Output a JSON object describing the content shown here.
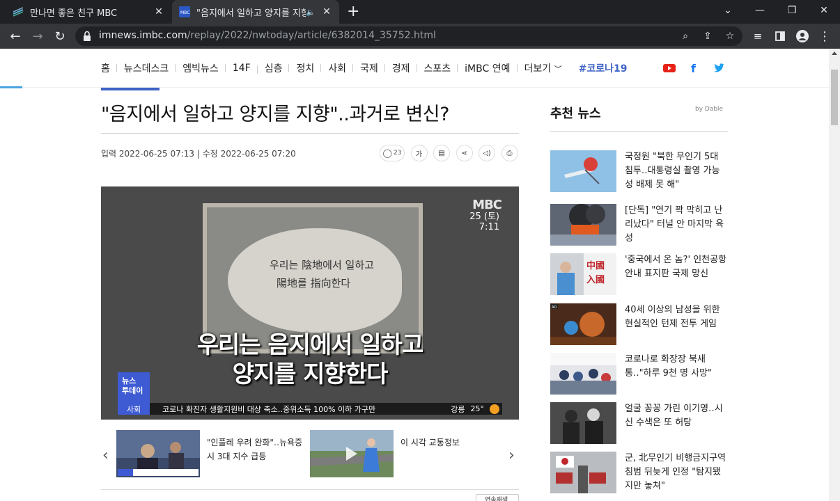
{
  "browser": {
    "tabs": [
      {
        "title": "만나면 좋은 친구 MBC",
        "active": false
      },
      {
        "title": "\"음지에서 일하고 양지를 지향\"..과거로 변신?",
        "active": true
      }
    ],
    "url_host": "imnews.imbc.com",
    "url_path": "/replay/2022/nwtoday/article/6382014_35752.html"
  },
  "nav": {
    "items": [
      "홈",
      "뉴스데스크",
      "엠빅뉴스",
      "14F",
      "심층",
      "정치",
      "사회",
      "국제",
      "경제",
      "스포츠",
      "iMBC 연예",
      "더보기"
    ],
    "covid": "#코로나19"
  },
  "article": {
    "headline": "\"음지에서 일하고 양지를 지향\"..과거로 변신?",
    "dates": "입력 2022-06-25 07:13 | 수정 2022-06-25 07:20",
    "comment_count": "23",
    "font_tool": "가"
  },
  "video": {
    "logo": "MBC",
    "date": "25 (토)",
    "time": "7:11",
    "rock_line1": "우리는 陰地에서 일하고",
    "rock_line2": "陽地를 指向한다",
    "caption1": "우리는 음지에서 일하고",
    "caption2": "양지를 지향한다",
    "badge_line1": "뉴스",
    "badge_line2": "투데이",
    "ticker_section": "사회",
    "ticker_text": "코로나 확진자 생활지원비 대상 축소‥중위소득 100% 이하 가구만",
    "weather_city": "강릉",
    "weather_temp": "25°"
  },
  "related": [
    {
      "title": "\"인플레 우려 완화\"‥뉴욕증시 3대 지수 급등"
    },
    {
      "title": "이 시각 교통정보"
    }
  ],
  "replay_label": "연속재생",
  "recommended": {
    "title": "추천 뉴스",
    "by": "by Dable",
    "items": [
      {
        "title": "국정원 \"북한 무인기 5대 침투‥대통령실 촬영 가능성 배제 못 해\""
      },
      {
        "title": "[단독] \"연기 꽉 막히고 난리났다\" 터널 안 마지막 육성"
      },
      {
        "title": "'중국에서 온 놈?' 인천공항 안내 표지판 국제 망신"
      },
      {
        "title": "40세 이상의 남성을 위한 현실적인 턴제 전투 게임"
      },
      {
        "title": "코로나로 화장장 북새통‥\"하루 9천 명 사망\""
      },
      {
        "title": "얼굴 꽁꽁 가린 이기영‥시신 수색은 또 허탕"
      },
      {
        "title": "군, 北무인기 비행금지구역 침범 뒤늦게 인정 \"탐지됐지만 놓쳐\""
      }
    ]
  },
  "colors": {
    "accent": "#3e62c5",
    "youtube": "#e62117",
    "facebook": "#1877f2",
    "twitter": "#1da1f2"
  }
}
